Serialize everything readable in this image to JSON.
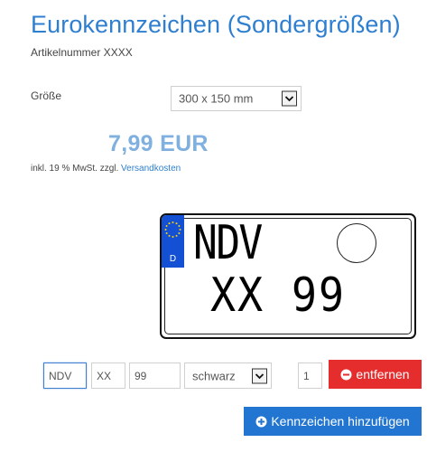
{
  "product": {
    "title": "Eurokennzeichen (Sondergrößen)",
    "article_number": "Artikelnummer XXXX"
  },
  "size": {
    "label": "Größe",
    "selected": "300 x 150 mm"
  },
  "price": {
    "value": "7,99 EUR",
    "vat_note": "inkl. 19 % MwSt. zzgl.",
    "shipping_link": "Versandkosten",
    "color": "#7fb0df"
  },
  "plate_preview": {
    "country_code": "D",
    "line1": "NDV",
    "line2": "XX 99",
    "eu_band_color": "#1450d4"
  },
  "plate_form": {
    "district": "NDV",
    "letters": "XX",
    "numbers": "99",
    "text_color": "schwarz",
    "quantity": "1",
    "remove_label": "entfernen",
    "remove_color": "#e52d2d"
  },
  "actions": {
    "add_label": "Kennzeichen hinzufügen",
    "add_color": "#2276d2"
  }
}
